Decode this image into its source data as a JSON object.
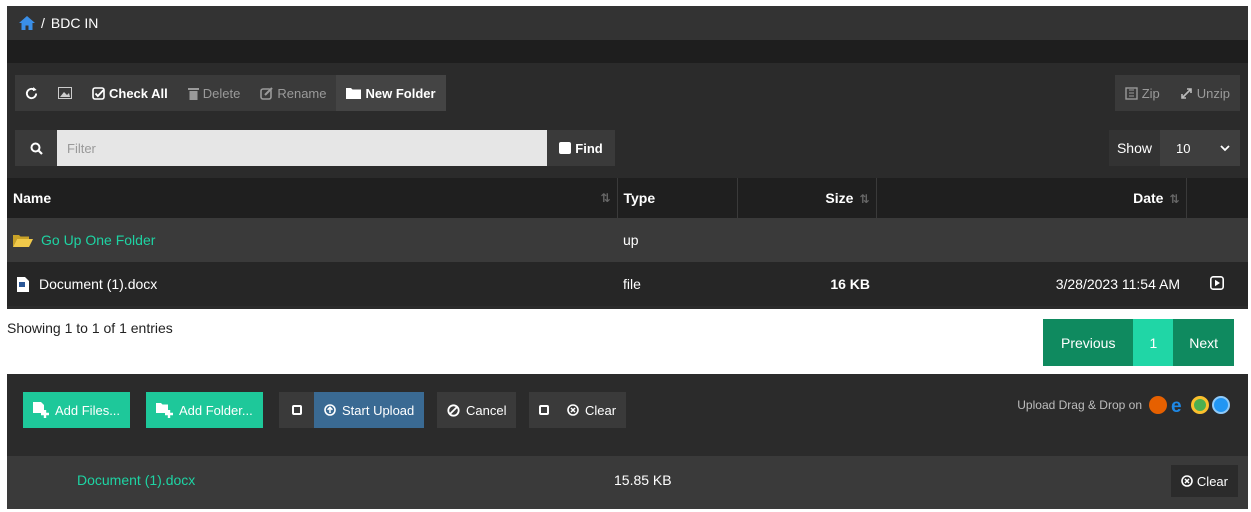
{
  "breadcrumb": {
    "separator": "/",
    "current": "BDC IN"
  },
  "toolbar": {
    "check_all": "Check All",
    "delete": "Delete",
    "rename": "Rename",
    "new_folder": "New Folder",
    "zip": "Zip",
    "unzip": "Unzip"
  },
  "filter": {
    "placeholder": "Filter",
    "find_label": "Find"
  },
  "show": {
    "label": "Show",
    "value": "10"
  },
  "table": {
    "columns": {
      "name": "Name",
      "type": "Type",
      "size": "Size",
      "date": "Date"
    },
    "rows": [
      {
        "name": "Go Up One Folder",
        "type": "up",
        "size": "",
        "date": ""
      },
      {
        "name": "Document (1).docx",
        "type": "file",
        "size": "16 KB",
        "date": "3/28/2023 11:54 AM"
      }
    ]
  },
  "info": {
    "text": "Showing 1 to 1 of 1 entries"
  },
  "pagination": {
    "previous": "Previous",
    "current": "1",
    "next": "Next"
  },
  "upload": {
    "add_files": "Add Files...",
    "add_folder": "Add Folder...",
    "start_upload": "Start Upload",
    "cancel": "Cancel",
    "clear": "Clear",
    "drag_drop_text": "Upload Drag & Drop on"
  },
  "queue": {
    "name": "Document (1).docx",
    "size": "15.85 KB",
    "clear": "Clear"
  },
  "colors": {
    "accent": "#1ed3a3",
    "pager": "#0f8a5f",
    "upload_blue": "#3a6a93"
  }
}
